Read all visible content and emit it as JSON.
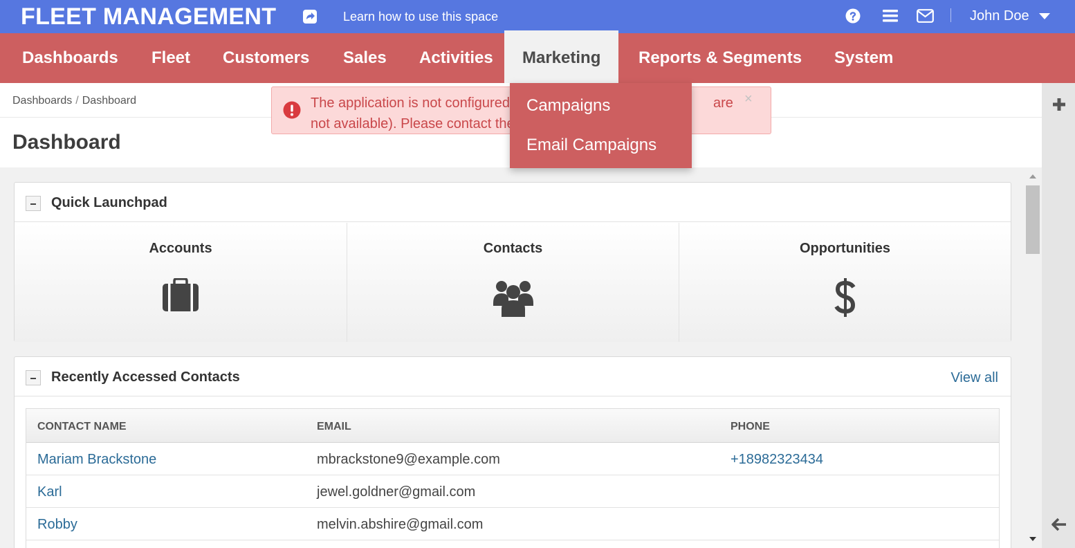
{
  "header": {
    "brand": "FLEET MANAGEMENT",
    "learn_link": "Learn how to use this space",
    "user_name": "John Doe"
  },
  "nav": {
    "items": [
      {
        "label": "Dashboards"
      },
      {
        "label": "Fleet"
      },
      {
        "label": "Customers"
      },
      {
        "label": "Sales"
      },
      {
        "label": "Activities"
      },
      {
        "label": "Marketing"
      },
      {
        "label": "Reports & Segments"
      },
      {
        "label": "System"
      }
    ],
    "active": "Marketing"
  },
  "dropdown": {
    "items": [
      {
        "label": "Campaigns"
      },
      {
        "label": "Email Campaigns"
      }
    ]
  },
  "breadcrumb": {
    "items": [
      "Dashboards",
      "Dashboard"
    ],
    "separator": "/"
  },
  "page": {
    "title": "Dashboard"
  },
  "alert": {
    "line1": "The application is not configured",
    "line1_tail": "are",
    "line2": "not available). Please contact the",
    "close": "×"
  },
  "quick_launchpad": {
    "title": "Quick Launchpad",
    "items": [
      {
        "label": "Accounts",
        "icon": "briefcase-icon"
      },
      {
        "label": "Contacts",
        "icon": "users-icon"
      },
      {
        "label": "Opportunities",
        "icon": "dollar-icon"
      }
    ]
  },
  "recent_contacts": {
    "title": "Recently Accessed Contacts",
    "view_all": "View all",
    "columns": [
      "CONTACT NAME",
      "EMAIL",
      "PHONE"
    ],
    "rows": [
      {
        "name": "Mariam Brackstone",
        "email": "mbrackstone9@example.com",
        "phone": "+18982323434"
      },
      {
        "name": "Karl",
        "email": "jewel.goldner@gmail.com",
        "phone": ""
      },
      {
        "name": "Robby",
        "email": "melvin.abshire@gmail.com",
        "phone": ""
      }
    ]
  },
  "colors": {
    "topbar": "#5677e0",
    "nav": "#cd5f60",
    "alert_bg": "#fcd9d9",
    "alert_text": "#c9474a",
    "link": "#2b6b97"
  }
}
